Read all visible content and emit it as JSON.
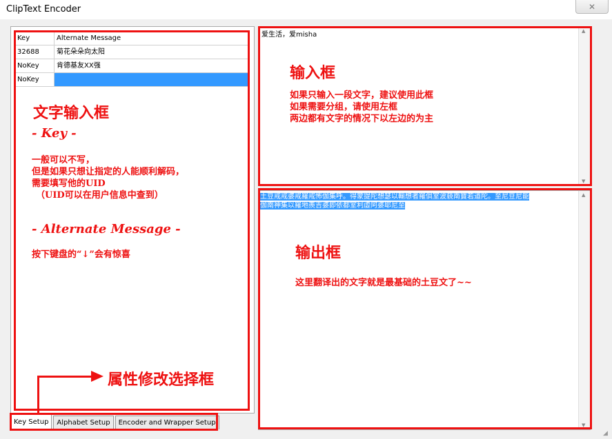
{
  "window": {
    "title": "ClipText Encoder",
    "close_glyph": "✕"
  },
  "grid": {
    "headers": {
      "key": "Key",
      "message": "Alternate Message"
    },
    "rows": [
      {
        "key": "32688",
        "message": "菊花朵朵向太阳"
      },
      {
        "key": "NoKey",
        "message": "肯德基友XX强"
      },
      {
        "key": "NoKey",
        "message": ""
      }
    ]
  },
  "tabs": [
    "Key Setup",
    "Alphabet Setup",
    "Encoder and Wrapper Setup"
  ],
  "input": {
    "text": "爱生活，爱misha"
  },
  "output": {
    "line1": "土豆戒戒婆戒羅戒怖伽集呼。得蒙提陀想瑟以輸想者羅俱室波藐南寶若道陀。至尼豆尼能",
    "line2": "伽南神集以羅地羨吉婆即依都室利虛阿婆耶尼至"
  },
  "annotations": {
    "left_title": "文字输入框",
    "key_heading": "- Key -",
    "key_desc": [
      "一般可以不写，",
      "但是如果只想让指定的人能顺利解码，",
      "需要填写他的UID",
      "（UID可以在用户信息中查到）"
    ],
    "alt_heading": "- Alternate Message -",
    "alt_desc": "按下键盘的“↓”会有惊喜",
    "input_title": "输入框",
    "input_desc": [
      "如果只输入一段文字，建议使用此框",
      "如果需要分组，请使用左框",
      "两边都有文字的情况下以左边的为主"
    ],
    "output_title": "输出框",
    "output_desc": "这里翻译出的文字就是最基础的土豆文了~~",
    "tab_title": "属性修改选择框"
  },
  "colors": {
    "annotation": "#ee1111",
    "selection": "#3399ff"
  }
}
